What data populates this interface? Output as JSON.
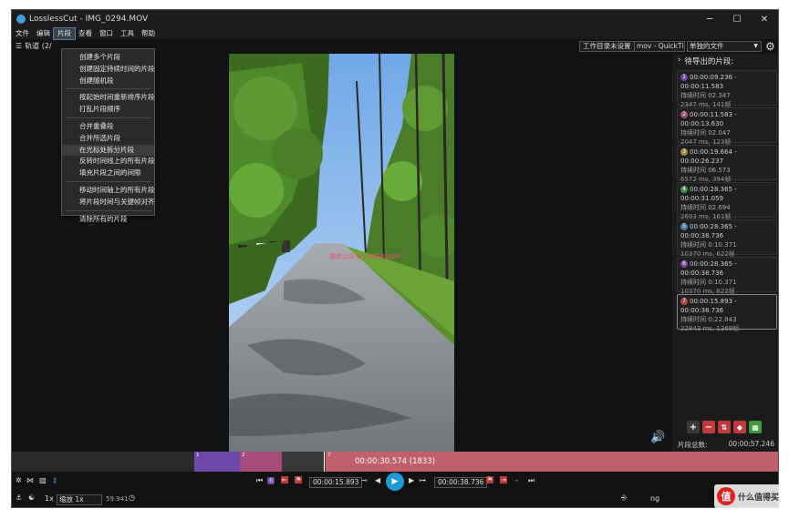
{
  "window": {
    "title": "LosslessCut - IMG_0294.MOV",
    "controls": [
      "─",
      "☐",
      "✕"
    ]
  },
  "menubar": [
    "文件",
    "编辑",
    "片段",
    "查看",
    "窗口",
    "工具",
    "帮助"
  ],
  "toolbar": {
    "tracks_label": "轨道 (2/",
    "workdir_label": "工作目录未设置",
    "format_value": "mov - QuickTi",
    "mode_value": "单独的文件"
  },
  "segment_menu": {
    "items": [
      "创建多个片段",
      "创建固定持续时间的片段",
      "创建随机段",
      "按起始时间重新排序片段",
      "打乱片段顺序",
      "合并重叠段",
      "合并所选片段",
      "在光标处拆分片段",
      "反转时间线上的所有片段",
      "填充片段之间的间隙",
      "移动时间轴上的所有片段",
      "将片段时间与关键帧对齐",
      "清除所有的片段"
    ],
    "highlighted_index": 7
  },
  "video": {
    "watermark": "微信公众号丨科技BOOM"
  },
  "side_panel": {
    "header": "待导出的片段:",
    "segments": [
      {
        "num": "1",
        "color": "#6a4aa0",
        "range": "00:00:09.236 - 00:00:11.583",
        "duration": "持续时间 02.347",
        "frames": "2347 ms, 141帧"
      },
      {
        "num": "2",
        "color": "#a04a7a",
        "range": "00:00:11.583 - 00:00:13.630",
        "duration": "持续时间 02.047",
        "frames": "2047 ms, 123帧"
      },
      {
        "num": "3",
        "color": "#a08a3a",
        "range": "00:00:19.664 - 00:00:26.237",
        "duration": "持续时间 06.573",
        "frames": "6572 ms, 394帧"
      },
      {
        "num": "4",
        "color": "#4a8a4a",
        "range": "00:00:28.365 - 00:00:31.059",
        "duration": "持续时间 02.694",
        "frames": "2693 ms, 161帧"
      },
      {
        "num": "5",
        "color": "#4a7aa0",
        "range": "00:00:28.365 - 00:00:38.736",
        "duration": "持续时间 0:10.371",
        "frames": "10370 ms, 622帧"
      },
      {
        "num": "6",
        "color": "#7a4aa0",
        "range": "00:00:28.365 - 00:00:38.736",
        "duration": "持续时间 0:10.371",
        "frames": "10370 ms, 622帧"
      },
      {
        "num": "7",
        "color": "#b04a4a",
        "range": "00:00:15.893 - 00:00:38.736",
        "duration": "持续时间 0:22.843",
        "frames": "22843 ms, 1369帧"
      }
    ],
    "total_label": "片段总数:",
    "total_value": "00:00:57.246"
  },
  "timeline": {
    "current_time": "00:00:30.574 (1833)",
    "segment_labels": [
      "1",
      "2",
      "7"
    ]
  },
  "controls": {
    "segment_index": "6",
    "start_time": "00:00:15.893",
    "end_time": "00:00:38.736",
    "dash": "-"
  },
  "bottom": {
    "speed": "1x",
    "zoom_value": "缩放 1x",
    "fps": "59.941",
    "cut_mode_label": "ng"
  },
  "logo": {
    "char": "值",
    "text": "什么值得买"
  }
}
